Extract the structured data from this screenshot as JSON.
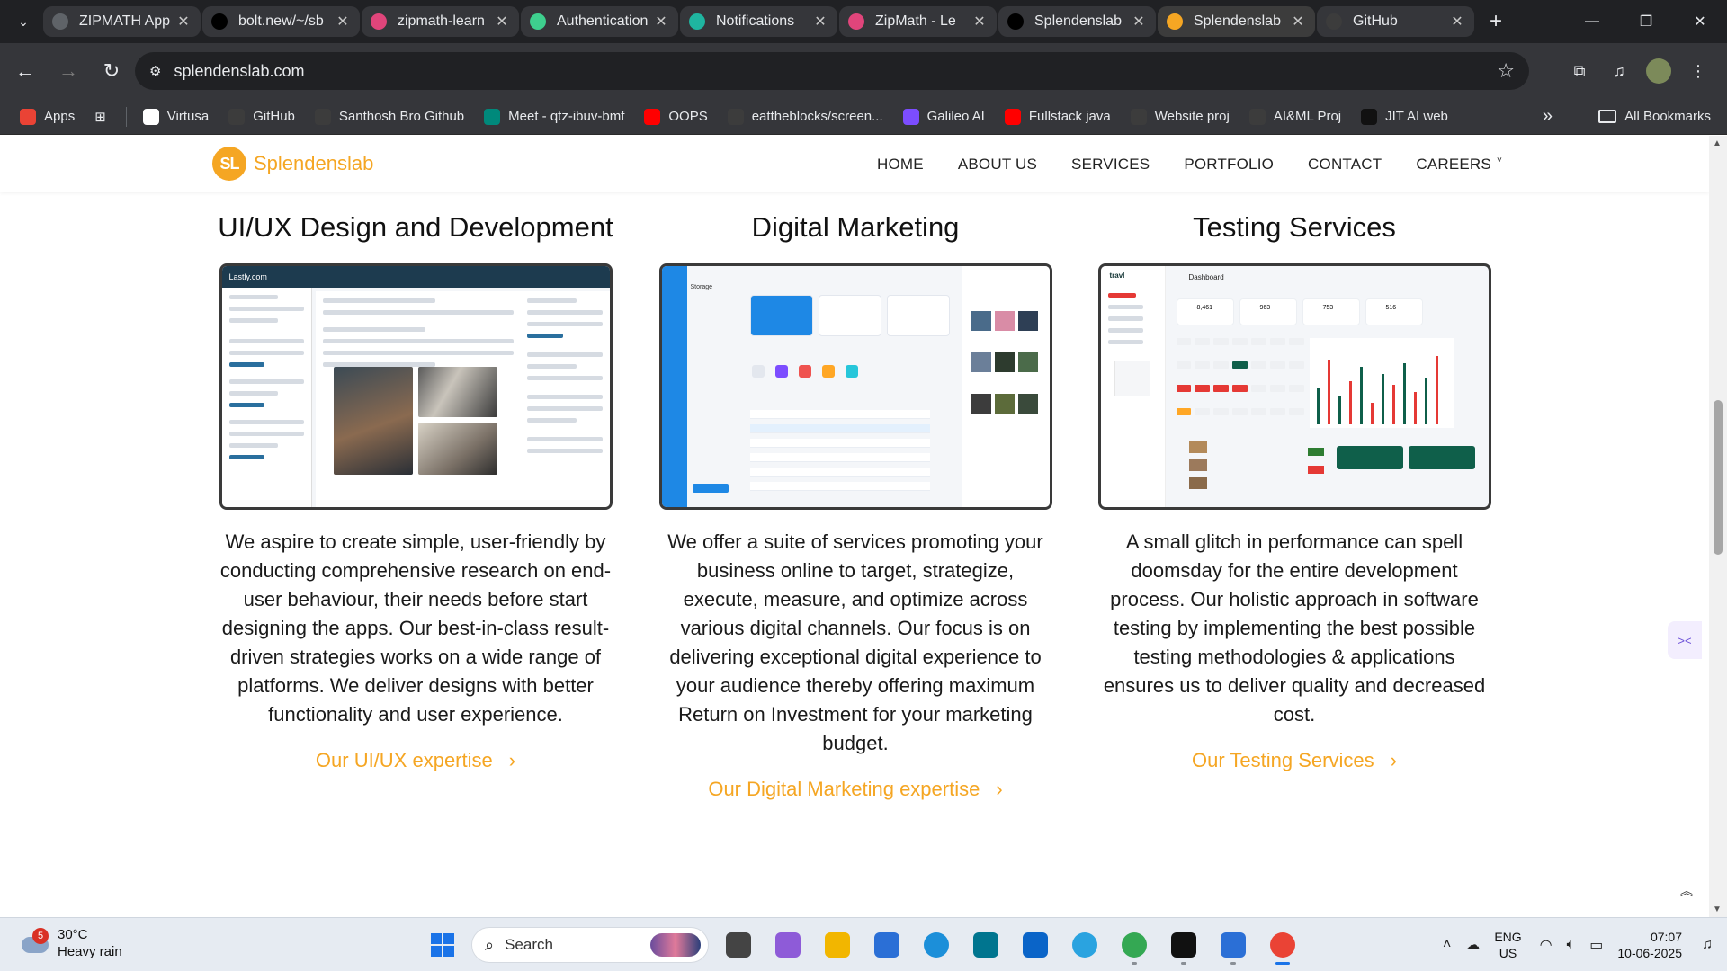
{
  "tabs": [
    {
      "title": "ZIPMATH App",
      "icon": "openai-icon",
      "color": "#5f6368"
    },
    {
      "title": "bolt.new/~/sb",
      "icon": "bolt-icon",
      "color": "#000000"
    },
    {
      "title": "zipmath-learn",
      "icon": "lovable-icon",
      "color": "#e0457b"
    },
    {
      "title": "Authentication",
      "icon": "supabase-auth-icon",
      "color": "#3ecf8e"
    },
    {
      "title": "Notifications",
      "icon": "diamond-icon",
      "color": "#1fb5a0"
    },
    {
      "title": "ZipMath - Le",
      "icon": "lovable-icon",
      "color": "#e0457b"
    },
    {
      "title": "Splendenslab",
      "icon": "vercel-icon",
      "color": "#000000"
    },
    {
      "title": "Splendenslab",
      "icon": "splendenslab-icon",
      "color": "#f5a623"
    },
    {
      "title": "GitHub",
      "icon": "github-icon",
      "color": "#3c3c3c"
    }
  ],
  "address_bar": {
    "url": "splendenslab.com"
  },
  "bookmarks": [
    {
      "label": "Apps",
      "icon": "apps-grid-icon",
      "color": "#ea4335"
    },
    {
      "label": "Virtusa",
      "icon": "virtusa-icon",
      "color": "#ffffff"
    },
    {
      "label": "GitHub",
      "icon": "github-icon",
      "color": "#3c3c3c"
    },
    {
      "label": "Santhosh Bro Github",
      "icon": "github-icon",
      "color": "#3c3c3c"
    },
    {
      "label": "Meet - qtz-ibuv-bmf",
      "icon": "meet-icon",
      "color": "#00897b"
    },
    {
      "label": "OOPS",
      "icon": "youtube-icon",
      "color": "#ff0000"
    },
    {
      "label": "eattheblocks/screen...",
      "icon": "github-icon",
      "color": "#3c3c3c"
    },
    {
      "label": "Galileo AI",
      "icon": "galileo-icon",
      "color": "#7c4dff"
    },
    {
      "label": "Fullstack java",
      "icon": "youtube-icon",
      "color": "#ff0000"
    },
    {
      "label": "Website proj",
      "icon": "github-icon",
      "color": "#3c3c3c"
    },
    {
      "label": "AI&ML Proj",
      "icon": "github-icon",
      "color": "#3c3c3c"
    },
    {
      "label": "JIT AI web",
      "icon": "jit-icon",
      "color": "#111111"
    }
  ],
  "all_bookmarks_label": "All Bookmarks",
  "site": {
    "logo_mark": "SL",
    "logo_text": "Splendenslab",
    "nav": [
      "HOME",
      "ABOUT US",
      "SERVICES",
      "PORTFOLIO",
      "CONTACT",
      "CAREERS"
    ],
    "accent": "#f5a623",
    "services": [
      {
        "title": "UI/UX Design and Development",
        "description": "We aspire to create simple, user-friendly by conducting comprehensive research on end-user behaviour, their needs before start designing the apps. Our best-in-class result-driven strategies works on a wide range of platforms. We deliver designs with better functionality and user experience.",
        "link": "Our UI/UX expertise",
        "mock_header": "Lastly.com"
      },
      {
        "title": "Digital Marketing",
        "description": "We offer a suite of services promoting your business online to target, strategize, execute, measure, and optimize across various digital channels. Our focus is on delivering exceptional digital experience to your audience thereby offering maximum Return on Investment for your marketing budget.",
        "link": "Our Digital Marketing expertise",
        "mock_header": "Storage"
      },
      {
        "title": "Testing Services",
        "description": "A small glitch in performance can spell doomsday for the entire development process. Our holistic approach in software testing by implementing the best possible testing methodologies & applications ensures us to deliver quality and decreased cost.",
        "link": "Our Testing Services",
        "mock_header": "Dashboard",
        "mock_brand": "travl",
        "mock_stats": [
          "8,461",
          "963",
          "753",
          "516"
        ]
      }
    ]
  },
  "taskbar": {
    "weather": {
      "temp": "30°C",
      "condition": "Heavy rain",
      "badge": "5"
    },
    "search_placeholder": "Search",
    "language": "ENG",
    "region": "US",
    "time": "07:07",
    "date": "10-06-2025"
  }
}
